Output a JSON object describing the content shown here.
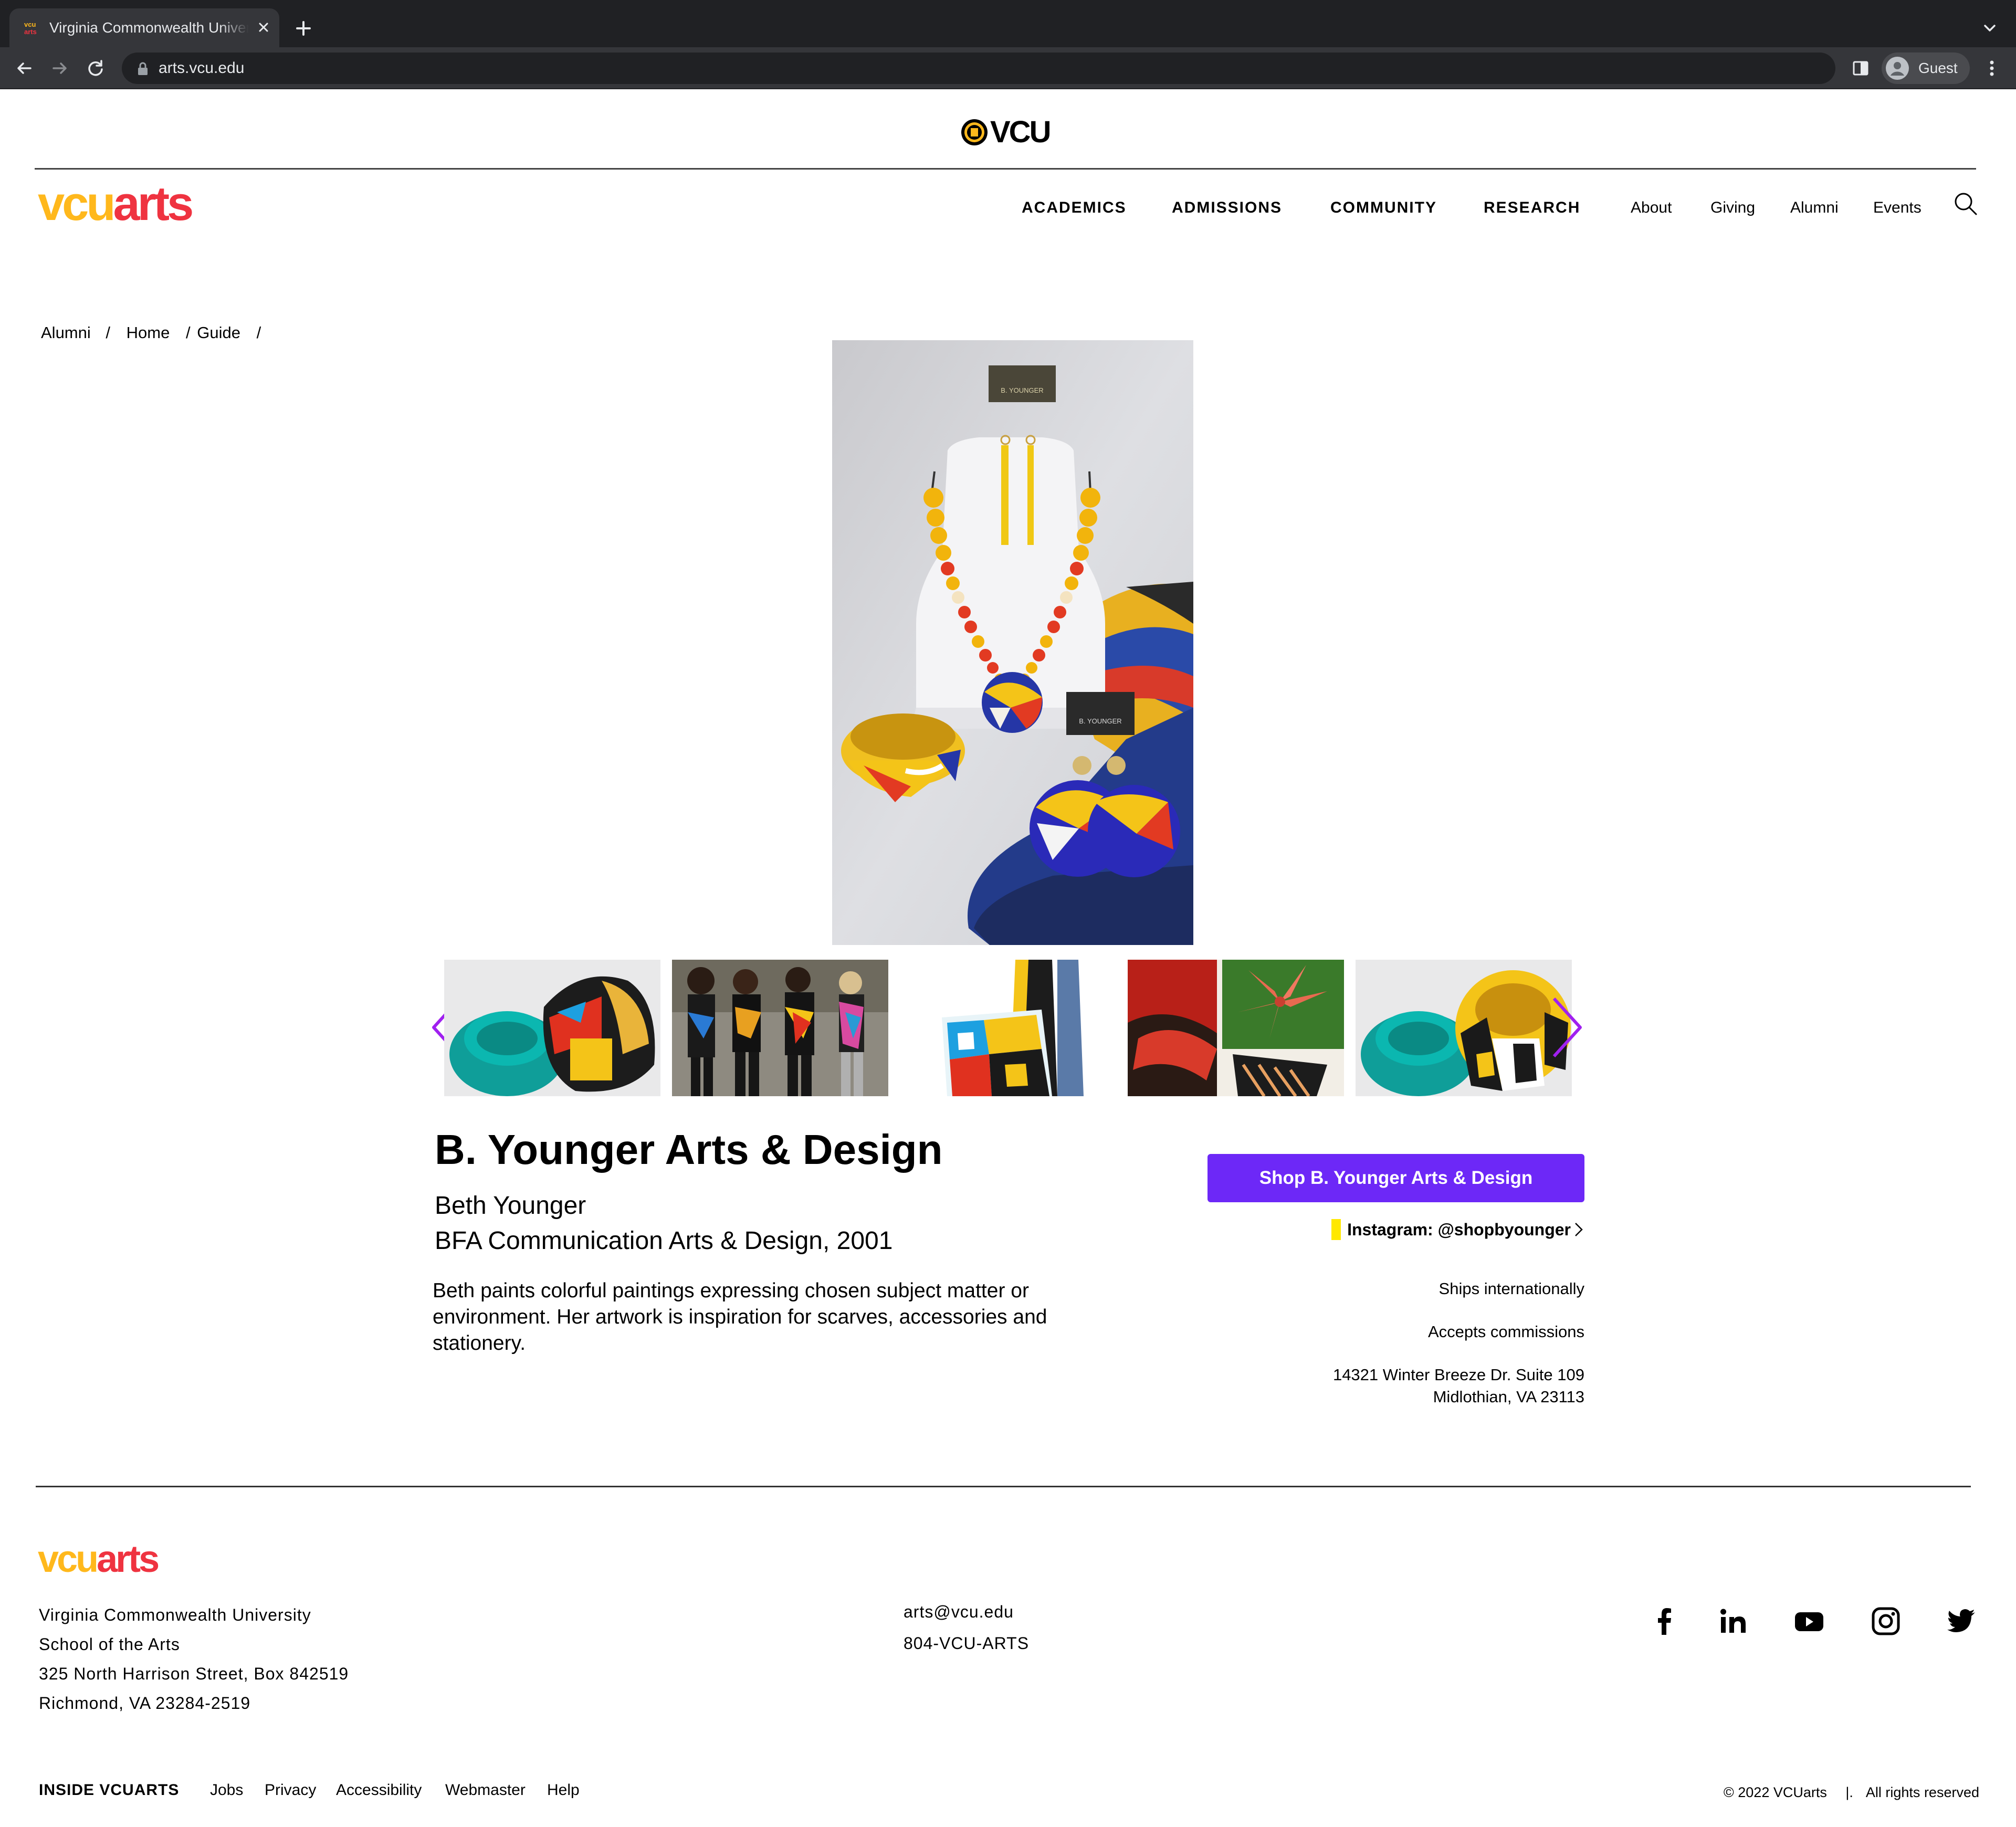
{
  "browser": {
    "tab_title": "Virginia Commonwealth University",
    "url": "arts.vcu.edu",
    "profile_name": "Guest"
  },
  "header": {
    "university_logo_text": "VCU",
    "brand_vcu": "vcu",
    "brand_arts": "arts",
    "main_nav": [
      "ACADEMICS",
      "ADMISSIONS",
      "COMMUNITY",
      "RESEARCH"
    ],
    "utility_nav": [
      "About",
      "Giving",
      "Alumni",
      "Events"
    ]
  },
  "breadcrumb": {
    "items": [
      "Alumni",
      "Home",
      "Guide"
    ],
    "separator": "/"
  },
  "gallery": {
    "hero_card_text": "B. YOUNGER",
    "thumbnails": [
      "bangles",
      "models",
      "scarf",
      "lily-painting",
      "bangles-yellow"
    ]
  },
  "detail": {
    "title": "B. Younger Arts & Design",
    "owner": "Beth Younger",
    "degree": "BFA Communication Arts & Design, 2001",
    "description": "Beth paints colorful paintings expressing chosen subject matter or environment. Her artwork is inspiration for scarves, accessories and stationery.",
    "shop_button": "Shop B. Younger Arts & Design",
    "instagram": "Instagram: @shopbyounger",
    "ships": "Ships internationally",
    "commissions": "Accepts commissions",
    "address_line1": "14321 Winter Breeze Dr. Suite 109",
    "address_line2": "Midlothian, VA 23113"
  },
  "footer": {
    "brand_vcu": "vcu",
    "brand_arts": "arts",
    "address": [
      "Virginia Commonwealth University",
      "School of the Arts",
      "325 North Harrison Street, Box 842519",
      "Richmond, VA 23284-2519"
    ],
    "email": "arts@vcu.edu",
    "phone": "804-VCU-ARTS",
    "social": [
      "facebook-icon",
      "linkedin-icon",
      "youtube-icon",
      "instagram-icon",
      "twitter-icon"
    ],
    "inside_label": "INSIDE VCUARTS",
    "links": [
      "Jobs",
      "Privacy",
      "Accessibility",
      "Webmaster",
      "Help"
    ],
    "copyright": "© 2022 VCUarts",
    "rights": "All rights reserved"
  },
  "colors": {
    "brand_yellow": "#ffb81c",
    "brand_red": "#ef3340",
    "button_purple": "#6d28f7",
    "arrow_purple": "#a020f0",
    "instagram_mark": "#ffe800"
  }
}
